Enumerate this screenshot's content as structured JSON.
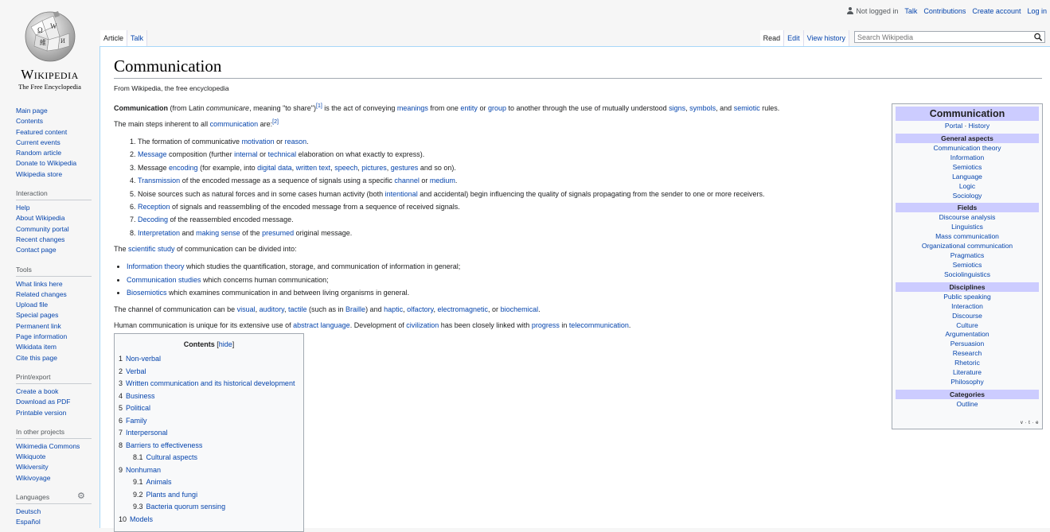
{
  "personal": {
    "not_logged_in": "Not logged in",
    "talk": "Talk",
    "contributions": "Contributions",
    "create_account": "Create account",
    "log_in": "Log in"
  },
  "logo": {
    "wordmark": "Wikipedia",
    "tagline": "The Free Encyclopedia"
  },
  "tabs_left": [
    "Article",
    "Talk"
  ],
  "tabs_right": [
    "Read",
    "Edit",
    "View history"
  ],
  "search": {
    "placeholder": "Search Wikipedia",
    "value": ""
  },
  "sidebar": {
    "main": [
      "Main page",
      "Contents",
      "Featured content",
      "Current events",
      "Random article",
      "Donate to Wikipedia",
      "Wikipedia store"
    ],
    "interaction_heading": "Interaction",
    "interaction": [
      "Help",
      "About Wikipedia",
      "Community portal",
      "Recent changes",
      "Contact page"
    ],
    "tools_heading": "Tools",
    "tools": [
      "What links here",
      "Related changes",
      "Upload file",
      "Special pages",
      "Permanent link",
      "Page information",
      "Wikidata item",
      "Cite this page"
    ],
    "print_heading": "Print/export",
    "print": [
      "Create a book",
      "Download as PDF",
      "Printable version"
    ],
    "projects_heading": "In other projects",
    "projects": [
      "Wikimedia Commons",
      "Wikiquote",
      "Wikiversity",
      "Wikivoyage"
    ],
    "languages_heading": "Languages",
    "languages": [
      "Deutsch",
      "Español"
    ]
  },
  "article": {
    "title": "Communication",
    "from": "From Wikipedia, the free encyclopedia",
    "p1": {
      "bold": "Communication",
      "t1": " (from Latin ",
      "italic": "communicare",
      "t2": ", meaning \"to share\")",
      "ref": "[1]",
      "t3": " is the act of conveying ",
      "l_meanings": "meanings",
      "t4": " from one ",
      "l_entity": "entity",
      "t5": " or ",
      "l_group": "group",
      "t6": " to another through the use of mutually understood ",
      "l_signs": "signs",
      "t7": ", ",
      "l_symbols": "symbols",
      "t8": ", and ",
      "l_semiotic": "semiotic",
      "t9": " rules."
    },
    "p2": {
      "t1": "The main steps inherent to all ",
      "l1": "communication",
      "t2": " are:",
      "ref": "[2]"
    },
    "steps": {
      "s1": {
        "t1": "The formation of communicative ",
        "l1": "motivation",
        "t2": " or ",
        "l2": "reason",
        "t3": "."
      },
      "s2": {
        "l1": "Message",
        "t1": " composition (further ",
        "l2": "internal",
        "t2": " or ",
        "l3": "technical",
        "t3": " elaboration on what exactly to express)."
      },
      "s3": {
        "t1": "Message ",
        "l1": "encoding",
        "t2": " (for example, into ",
        "l2": "digital data",
        "t3": ", ",
        "l3": "written text",
        "t4": ", ",
        "l4": "speech",
        "t5": ", ",
        "l5": "pictures",
        "t6": ", ",
        "l6": "gestures",
        "t7": " and so on)."
      },
      "s4": {
        "l1": "Transmission",
        "t1": " of the encoded message as a sequence of signals using a specific ",
        "l2": "channel",
        "t2": " or ",
        "l3": "medium",
        "t3": "."
      },
      "s5": {
        "t1": "Noise sources such as natural forces and in some cases human activity (both ",
        "l1": "intentional",
        "t2": " and accidental) begin influencing the quality of signals propagating from the sender to one or more receivers."
      },
      "s6": {
        "l1": "Reception",
        "t1": " of signals and reassembling of the encoded message from a sequence of received signals."
      },
      "s7": {
        "l1": "Decoding",
        "t1": " of the reassembled encoded message."
      },
      "s8": {
        "l1": "Interpretation",
        "t1": " and ",
        "l2": "making sense",
        "t2": " of the ",
        "l3": "presumed",
        "t3": " original message."
      }
    },
    "p3": {
      "t1": "The ",
      "l1": "scientific study",
      "t2": " of communication can be divided into:"
    },
    "bullets": {
      "b1": {
        "l1": "Information theory",
        "t1": " which studies the quantification, storage, and communication of information in general;"
      },
      "b2": {
        "l1": "Communication studies",
        "t1": " which concerns human communication;"
      },
      "b3": {
        "l1": "Biosemiotics",
        "t1": " which examines communication in and between living organisms in general."
      }
    },
    "p4": {
      "t1": "The channel of communication can be ",
      "l1": "visual",
      "t2": ", ",
      "l2": "auditory",
      "t3": ", ",
      "l3": "tactile",
      "t4": " (such as in ",
      "l4": "Braille",
      "t5": ") and ",
      "l5": "haptic",
      "t6": ", ",
      "l6": "olfactory",
      "t7": ", ",
      "l7": "electromagnetic",
      "t8": ", or ",
      "l8": "biochemical",
      "t9": "."
    },
    "p5": {
      "t1": "Human communication is unique for its extensive use of ",
      "l1": "abstract language",
      "t2": ". Development of ",
      "l2": "civilization",
      "t3": " has been closely linked with ",
      "l3": "progress",
      "t4": " in ",
      "l4": "telecommunication",
      "t5": "."
    }
  },
  "toc": {
    "title": "Contents",
    "hide_open": " [",
    "hide": "hide",
    "hide_close": "]",
    "items": [
      {
        "num": "1",
        "label": "Non-verbal",
        "sub": false
      },
      {
        "num": "2",
        "label": "Verbal",
        "sub": false
      },
      {
        "num": "3",
        "label": "Written communication and its historical development",
        "sub": false
      },
      {
        "num": "4",
        "label": "Business",
        "sub": false
      },
      {
        "num": "5",
        "label": "Political",
        "sub": false
      },
      {
        "num": "6",
        "label": "Family",
        "sub": false
      },
      {
        "num": "7",
        "label": "Interpersonal",
        "sub": false
      },
      {
        "num": "8",
        "label": "Barriers to effectiveness",
        "sub": false
      },
      {
        "num": "8.1",
        "label": "Cultural aspects",
        "sub": true
      },
      {
        "num": "9",
        "label": "Nonhuman",
        "sub": false
      },
      {
        "num": "9.1",
        "label": "Animals",
        "sub": true
      },
      {
        "num": "9.2",
        "label": "Plants and fungi",
        "sub": true
      },
      {
        "num": "9.3",
        "label": "Bacteria quorum sensing",
        "sub": true
      },
      {
        "num": "10",
        "label": "Models",
        "sub": false
      }
    ]
  },
  "infobox": {
    "title": "Communication",
    "portal": "Portal",
    "sep": " · ",
    "history": "History",
    "sections": [
      {
        "heading": "General aspects",
        "items": [
          "Communication theory",
          "Information",
          "Semiotics",
          "Language",
          "Logic",
          "Sociology"
        ]
      },
      {
        "heading": "Fields",
        "items": [
          "Discourse analysis",
          "Linguistics",
          "Mass communication",
          "Organizational communication",
          "Pragmatics",
          "Semiotics",
          "Sociolinguistics"
        ]
      },
      {
        "heading": "Disciplines",
        "items": [
          "Public speaking",
          "Interaction",
          "Discourse",
          "Culture",
          "Argumentation",
          "Persuasion",
          "Research",
          "Rhetoric",
          "Literature",
          "Philosophy"
        ]
      },
      {
        "heading": "Categories",
        "items": [
          "Outline"
        ]
      }
    ],
    "vte": "v · t · e"
  },
  "colors": {
    "link": "#0645ad",
    "infobox_header": "#ccccff",
    "border": "#a7d7f9"
  }
}
